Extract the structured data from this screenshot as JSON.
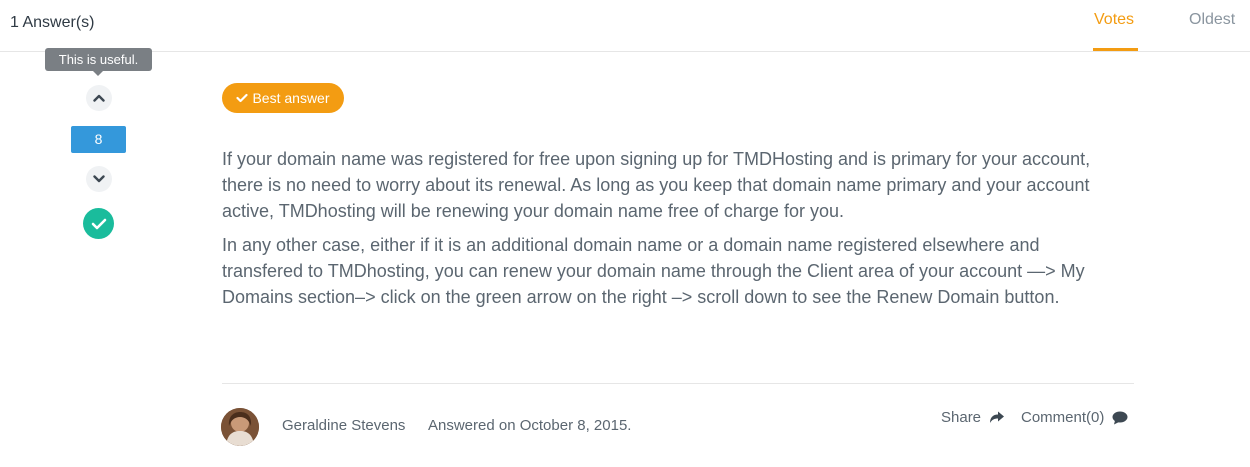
{
  "header": {
    "answers_count": "1 Answer(s)",
    "tabs": [
      {
        "label": "Votes",
        "active": true
      },
      {
        "label": "Oldest",
        "active": false
      }
    ]
  },
  "vote": {
    "tooltip": "This is useful.",
    "count": "8",
    "up_icon": "chevron-up-icon",
    "down_icon": "chevron-down-icon",
    "accepted_icon": "check-circle-icon"
  },
  "answer": {
    "badge_label": "Best answer",
    "paragraphs": [
      "If your domain name was registered for free upon signing up for TMDHosting and is primary for your account, there is no need to worry about its renewal. As long as you keep that domain name primary and your account active, TMDhosting will be renewing your domain name free of charge for you.",
      "In any other case, either if it is an additional domain name or a domain name registered elsewhere and transfered to TMDhosting, you can renew your domain name through the Client area of your account —> My Domains section–> click on the green arrow on the right –> scroll down to see the Renew Domain button."
    ],
    "author": "Geraldine Stevens",
    "answered_on": "Answered on October 8, 2015.",
    "share_label": "Share",
    "comment_label": "Comment(0)"
  },
  "colors": {
    "accent": "#f39c12",
    "vote_count_bg": "#3498db",
    "accepted": "#1abc9c"
  }
}
